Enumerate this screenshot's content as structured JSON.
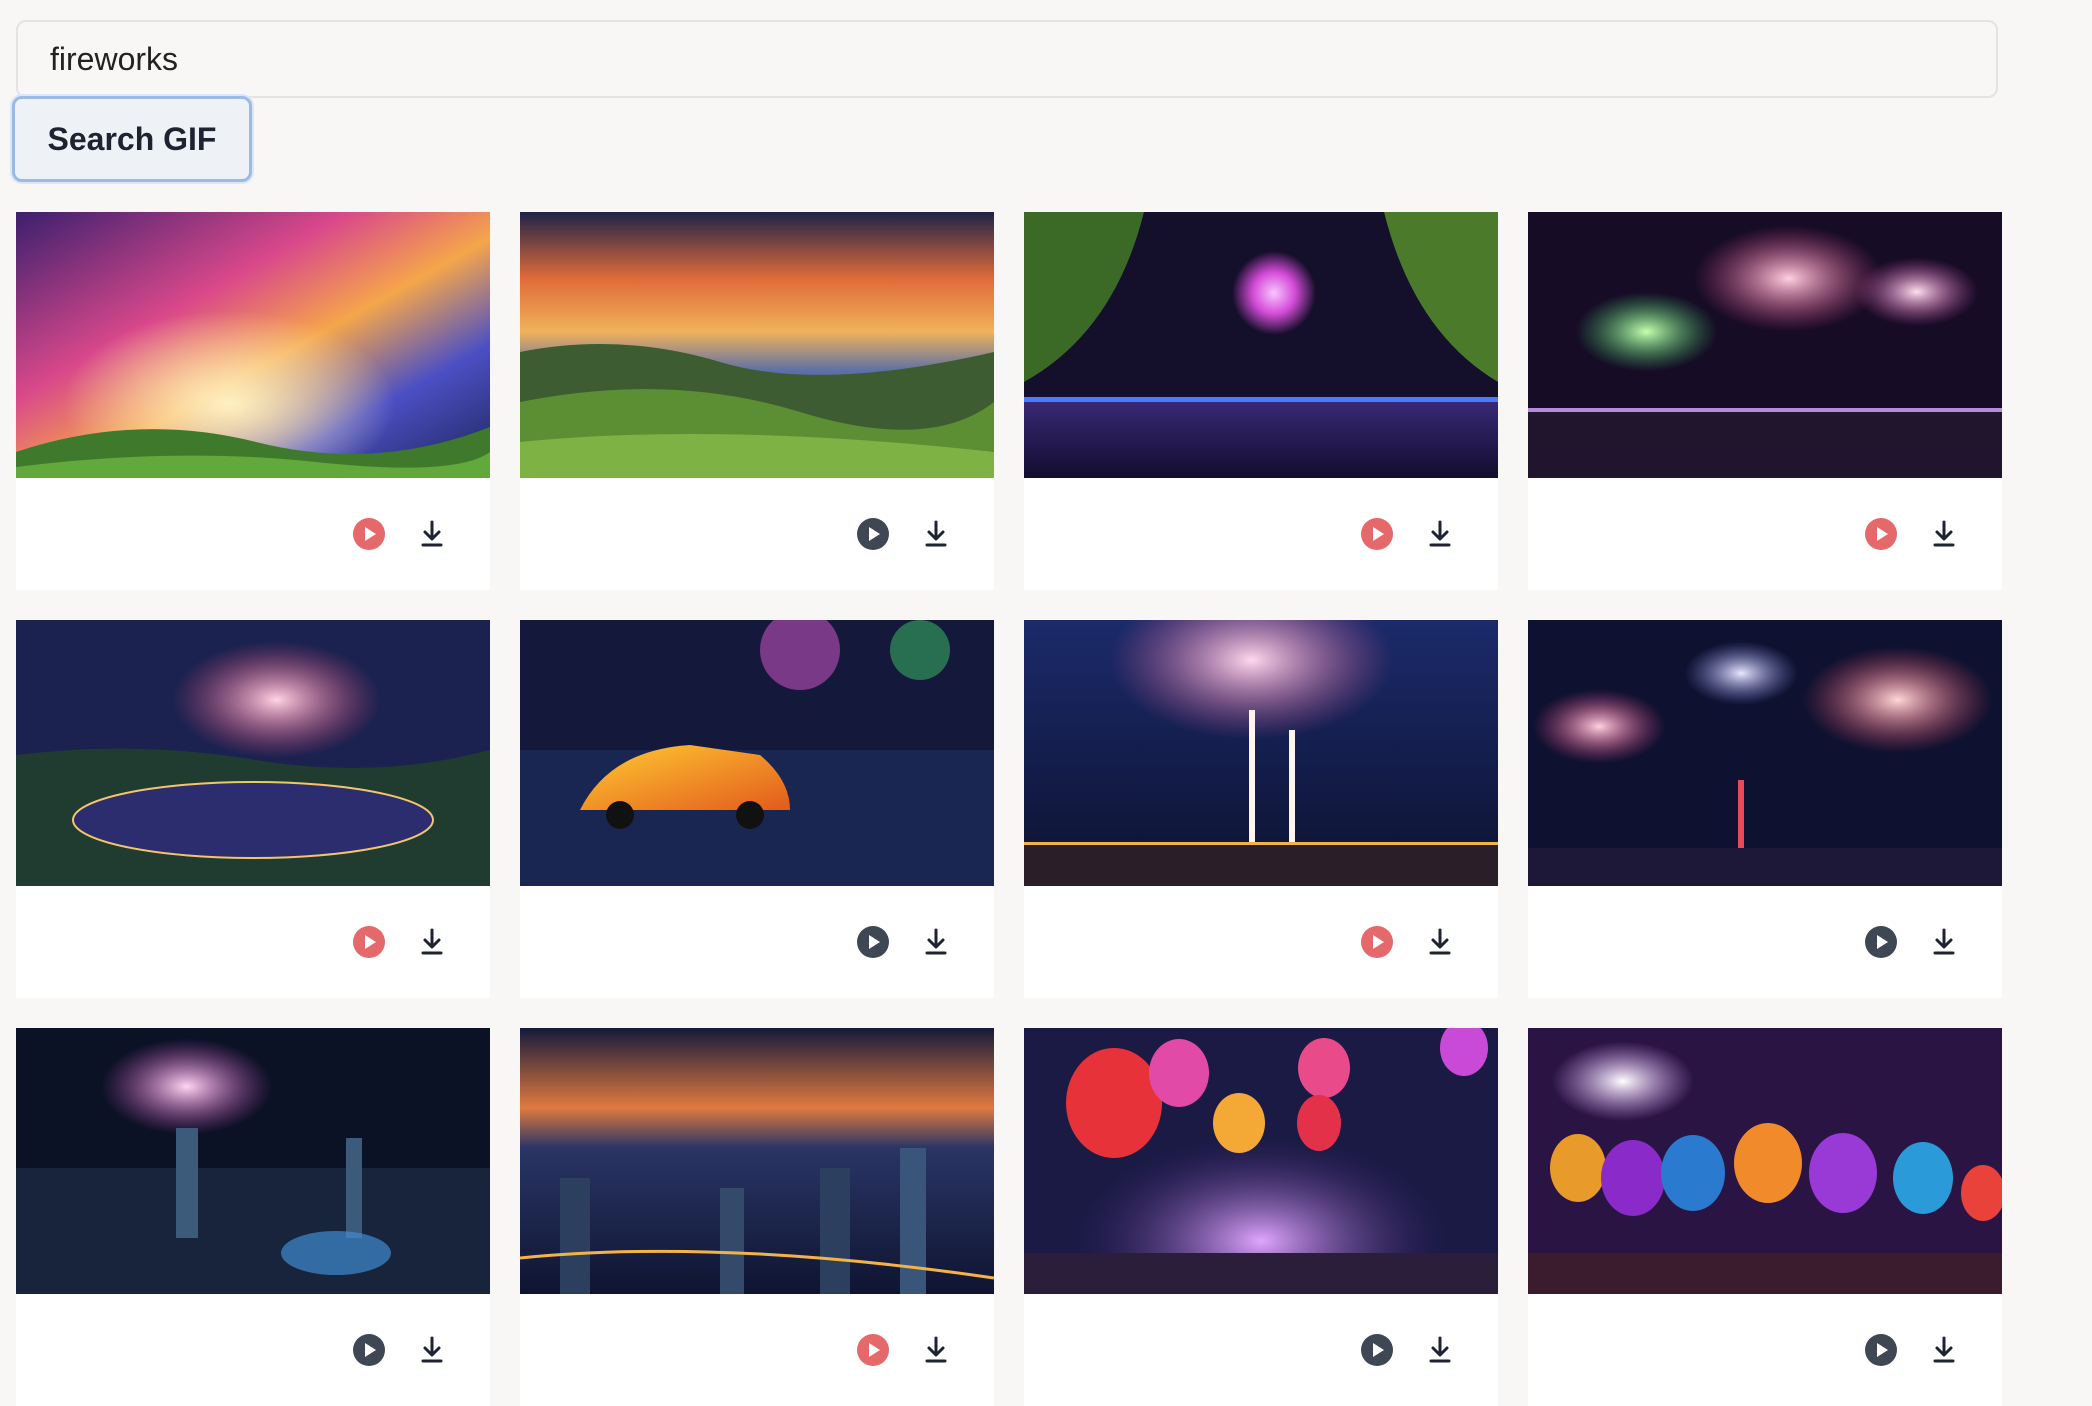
{
  "search": {
    "value": "fireworks",
    "button_label": "Search GIF"
  },
  "colors": {
    "play_active": "#e5686a",
    "play_idle": "#3f4654",
    "button_border": "#9bbbe6"
  },
  "results": [
    {
      "scene": "aurora-sky-over-hills",
      "play_state": "active"
    },
    {
      "scene": "sunset-clouds-over-green-valley",
      "play_state": "idle"
    },
    {
      "scene": "fireworks-over-lake-with-trees",
      "play_state": "active"
    },
    {
      "scene": "fireworks-over-harbor",
      "play_state": "active"
    },
    {
      "scene": "fireworks-over-lit-park-lake",
      "play_state": "active"
    },
    {
      "scene": "orange-car-with-fireworks-over-sea",
      "play_state": "idle"
    },
    {
      "scene": "fireworks-fountain-over-city",
      "play_state": "active"
    },
    {
      "scene": "fireworks-over-city-tower-skyline",
      "play_state": "idle"
    },
    {
      "scene": "fireworks-over-night-city-aerial",
      "play_state": "idle"
    },
    {
      "scene": "night-city-skyline-at-dusk",
      "play_state": "active"
    },
    {
      "scene": "balloons-and-fireworks-over-crowd",
      "play_state": "idle"
    },
    {
      "scene": "colorful-balloons-party-fireworks",
      "play_state": "idle"
    }
  ]
}
